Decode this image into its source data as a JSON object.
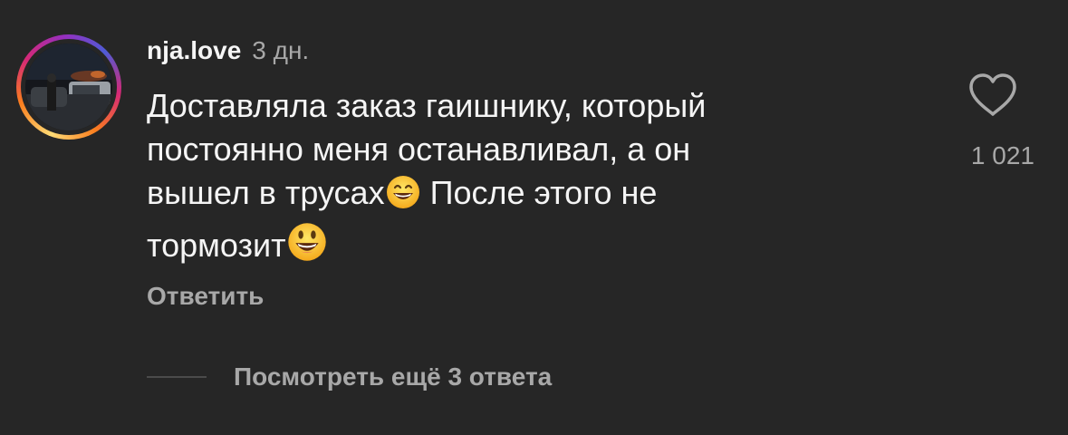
{
  "comment": {
    "username": "nja.love",
    "timestamp": "3 дн.",
    "text_lines": [
      "Доставляла заказ гаишнику, который",
      "постоянно меня останавливал, а он",
      "вышел в трусах",
      " После этого не",
      "тормозит"
    ],
    "emojis": [
      "grinning-smiling-eyes-emoji",
      "smiley-emoji"
    ],
    "like_count": "1 021",
    "reply_label": "Ответить",
    "view_replies_label": "Посмотреть ещё 3 ответа"
  },
  "icons": {
    "like": "heart-outline-icon"
  },
  "colors": {
    "background": "#262626",
    "primary_text": "#f5f5f5",
    "secondary_text": "#a8a8a8",
    "story_ring": [
      "#feda75",
      "#fa7e1e",
      "#d62976",
      "#962fbf",
      "#4f5bd5"
    ]
  }
}
